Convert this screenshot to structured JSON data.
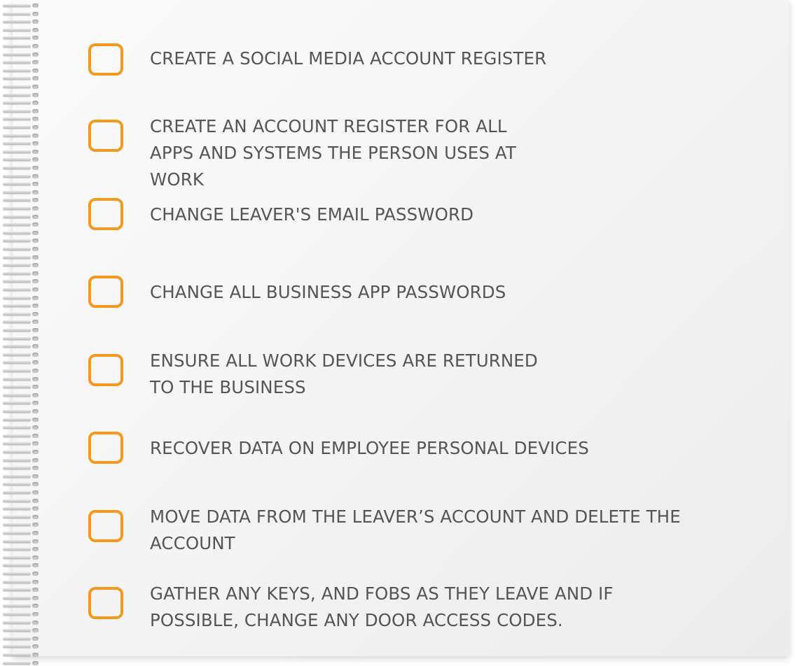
{
  "checklist": {
    "items": [
      {
        "label": "CREATE A SOCIAL MEDIA ACCOUNT REGISTER",
        "checked": false
      },
      {
        "label": "CREATE AN ACCOUNT REGISTER FOR ALL APPS AND SYSTEMS THE PERSON USES AT WORK",
        "checked": false
      },
      {
        "label": "CHANGE LEAVER'S EMAIL PASSWORD",
        "checked": false
      },
      {
        "label": "CHANGE ALL BUSINESS APP PASSWORDS",
        "checked": false
      },
      {
        "label": "ENSURE ALL WORK DEVICES ARE RETURNED TO THE BUSINESS",
        "checked": false
      },
      {
        "label": "RECOVER DATA ON EMPLOYEE PERSONAL DEVICES",
        "checked": false
      },
      {
        "label": "MOVE DATA FROM THE LEAVER’S ACCOUNT AND DELETE THE ACCOUNT",
        "checked": false
      },
      {
        "label": "GATHER ANY KEYS, AND FOBS AS THEY LEAVE AND IF POSSIBLE, CHANGE ANY DOOR ACCESS CODES.",
        "checked": false
      }
    ]
  },
  "colors": {
    "checkbox_border": "#f39a1e",
    "label_text": "#555555",
    "paper": "#f6f6f6"
  }
}
